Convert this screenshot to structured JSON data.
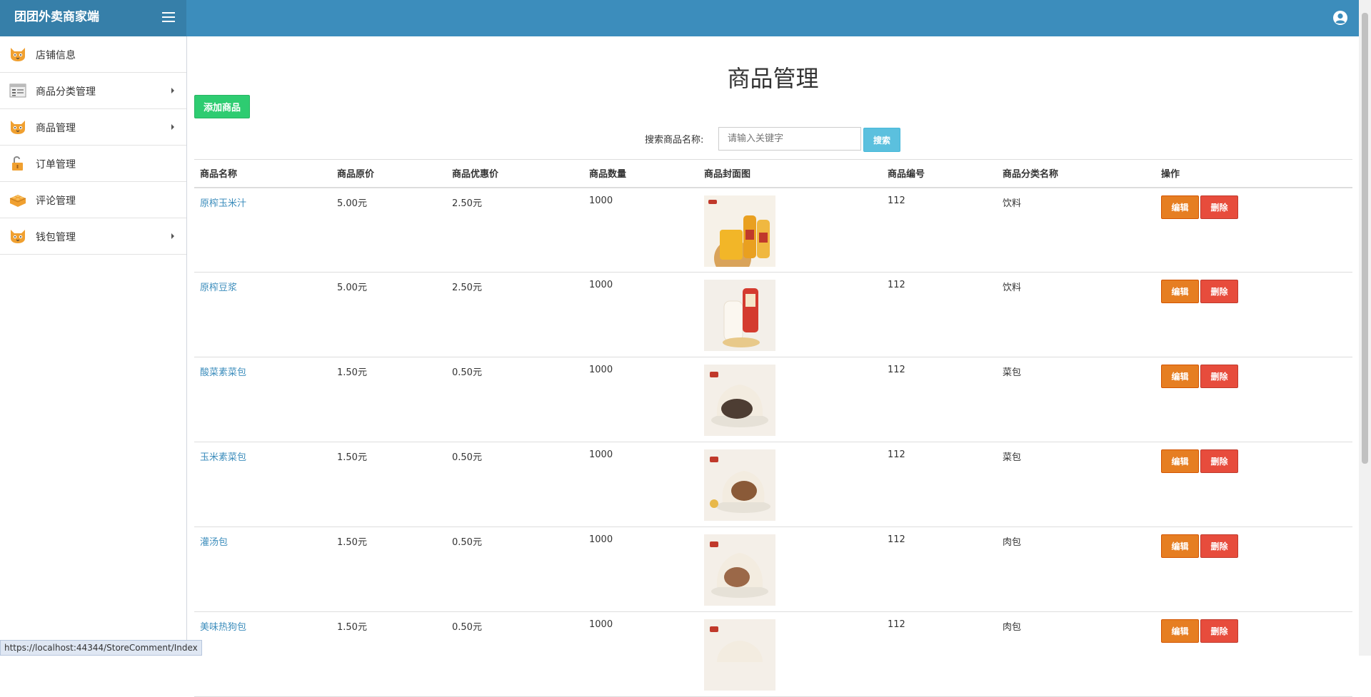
{
  "header": {
    "brand": "团团外卖商家端",
    "accent": "#3c8dbc"
  },
  "sidebar": {
    "items": [
      {
        "label": "店铺信息",
        "icon": "cat-face-icon",
        "has_submenu": false
      },
      {
        "label": "商品分类管理",
        "icon": "list-window-icon",
        "has_submenu": true
      },
      {
        "label": "商品管理",
        "icon": "cat-face-icon",
        "has_submenu": true
      },
      {
        "label": "订单管理",
        "icon": "padlock-open-icon",
        "has_submenu": false
      },
      {
        "label": "评论管理",
        "icon": "lego-brick-icon",
        "has_submenu": false
      },
      {
        "label": "钱包管理",
        "icon": "cat-face-icon",
        "has_submenu": true
      }
    ]
  },
  "main": {
    "title": "商品管理",
    "add_button": "添加商品",
    "search": {
      "label": "搜索商品名称:",
      "placeholder": "请输入关键字",
      "button": "搜索"
    },
    "table": {
      "headers": [
        "商品名称",
        "商品原价",
        "商品优惠价",
        "商品数量",
        "商品封面图",
        "商品编号",
        "商品分类名称",
        "操作"
      ],
      "rows": [
        {
          "name": "原榨玉米汁",
          "price": "5.00元",
          "discount": "2.50元",
          "qty": "1000",
          "image": "corn-juice-bottles",
          "code": "112",
          "category": "饮料"
        },
        {
          "name": "原榨豆浆",
          "price": "5.00元",
          "discount": "2.50元",
          "qty": "1000",
          "image": "soy-milk-bottle",
          "code": "112",
          "category": "饮料"
        },
        {
          "name": "酸菜素菜包",
          "price": "1.50元",
          "discount": "0.50元",
          "qty": "1000",
          "image": "steamed-bun-dark",
          "code": "112",
          "category": "菜包"
        },
        {
          "name": "玉米素菜包",
          "price": "1.50元",
          "discount": "0.50元",
          "qty": "1000",
          "image": "steamed-bun-corn",
          "code": "112",
          "category": "菜包"
        },
        {
          "name": "灌汤包",
          "price": "1.50元",
          "discount": "0.50元",
          "qty": "1000",
          "image": "soup-bun",
          "code": "112",
          "category": "肉包"
        },
        {
          "name": "美味热狗包",
          "price": "1.50元",
          "discount": "0.50元",
          "qty": "1000",
          "image": "hotdog-bun",
          "code": "112",
          "category": "肉包"
        }
      ],
      "edit_label": "编辑",
      "delete_label": "删除"
    }
  },
  "status_bar": {
    "url": "https://localhost:44344/StoreComment/Index"
  }
}
